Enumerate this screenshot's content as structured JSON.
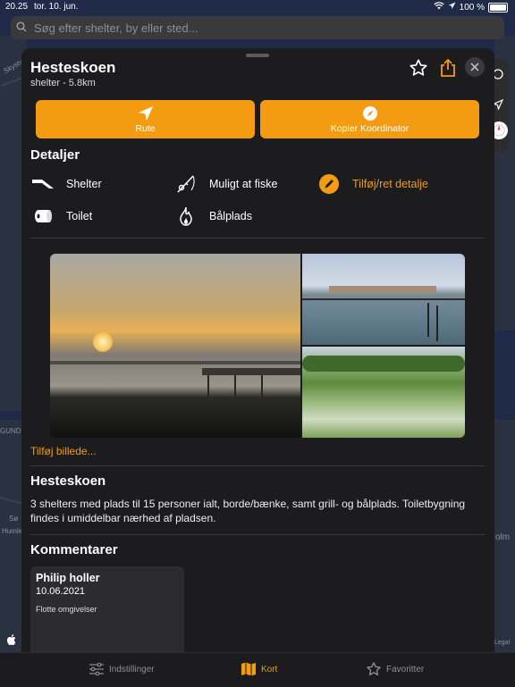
{
  "status": {
    "time": "20.25",
    "date": "tor. 10. jun.",
    "battery": "100 %"
  },
  "search": {
    "placeholder": "Søg efter shelter, by eller sted..."
  },
  "map": {
    "labels": [
      "Skystvejen",
      "Humle",
      "olm",
      "GUND",
      "Sø",
      "Legal"
    ]
  },
  "sheet": {
    "title": "Hesteskoen",
    "subtitle": "shelter - 5.8km",
    "buttons": {
      "route": "Rute",
      "copy": "Kopier Koordinator"
    },
    "details_heading": "Detaljer",
    "details": [
      {
        "label": "Shelter",
        "icon": "shelter-icon"
      },
      {
        "label": "Muligt at fiske",
        "icon": "fishing-icon"
      },
      {
        "label": "Tilføj/ret detalje",
        "icon": "edit-icon"
      },
      {
        "label": "Toilet",
        "icon": "toilet-icon"
      },
      {
        "label": "Bålplads",
        "icon": "fire-icon"
      }
    ],
    "add_photo": "Tilføj billede...",
    "desc_heading": "Hesteskoen",
    "description": "3 shelters med plads til 15 personer ialt, borde/bænke, samt grill- og bålplads. Toiletbygning findes i umiddelbar nærhed af pladsen.",
    "comments_heading": "Kommentarer",
    "comments": [
      {
        "name": "Philip holler",
        "date": "10.06.2021",
        "text": "Flotte omgivelser"
      }
    ]
  },
  "tabs": [
    {
      "label": "Indstillinger",
      "icon": "sliders-icon"
    },
    {
      "label": "Kort",
      "icon": "map-icon"
    },
    {
      "label": "Favoritter",
      "icon": "star-icon"
    }
  ],
  "colors": {
    "accent": "#f39c12",
    "sheet": "#1c1c1e"
  }
}
